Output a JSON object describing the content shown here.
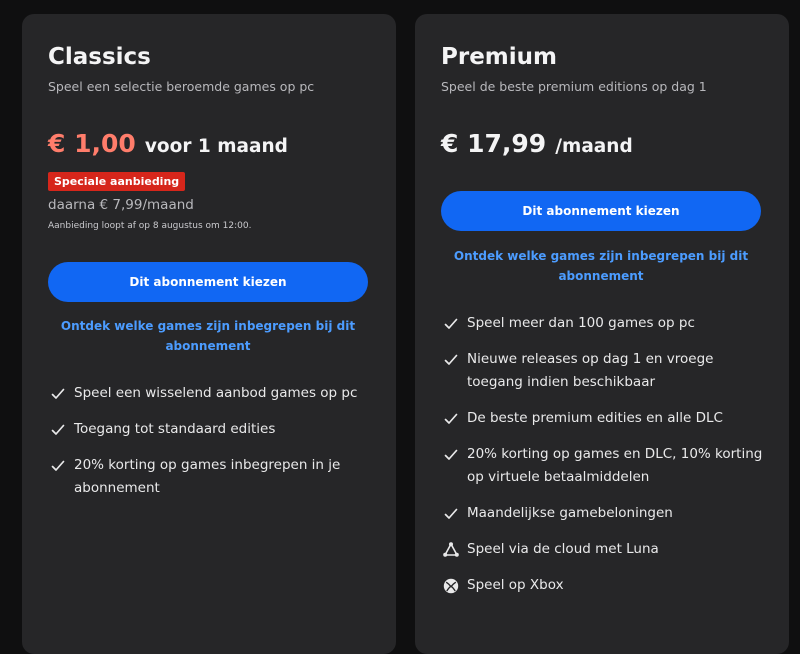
{
  "plans": [
    {
      "title": "Classics",
      "subtitle": "Speel een selectie beroemde games op pc",
      "price": "€ 1,00",
      "price_suffix": "voor 1 maand",
      "badge": "Speciale aanbieding",
      "after_price": "daarna € 7,99/maand",
      "offer_note": "Aanbieding loopt af op 8 augustus om 12:00.",
      "button_label": "Dit abonnement kiezen",
      "discover_link": "Ontdek welke games zijn inbegrepen bij dit abonnement",
      "features": [
        {
          "icon": "check-icon",
          "text": "Speel een wisselend aanbod games op pc"
        },
        {
          "icon": "check-icon",
          "text": "Toegang tot standaard edities"
        },
        {
          "icon": "check-icon",
          "text": "20% korting op games inbegrepen in je abonnement"
        }
      ]
    },
    {
      "title": "Premium",
      "subtitle": "Speel de beste premium editions op dag 1",
      "price": "€ 17,99",
      "price_suffix": "/maand",
      "button_label": "Dit abonnement kiezen",
      "discover_link": "Ontdek welke games zijn inbegrepen bij dit abonnement",
      "features": [
        {
          "icon": "check-icon",
          "text": "Speel meer dan 100 games op pc"
        },
        {
          "icon": "check-icon",
          "text": "Nieuwe releases op dag 1 en vroege toegang indien beschikbaar"
        },
        {
          "icon": "check-icon",
          "text": "De beste premium edities en alle DLC"
        },
        {
          "icon": "check-icon",
          "text": "20% korting op games en DLC, 10% korting op virtuele betaalmiddelen"
        },
        {
          "icon": "check-icon",
          "text": "Maandelijkse gamebeloningen"
        },
        {
          "icon": "luna-icon",
          "text": "Speel via de cloud met Luna"
        },
        {
          "icon": "xbox-icon",
          "text": "Speel op Xbox"
        }
      ]
    }
  ],
  "colors": {
    "accent_blue": "#1167f3",
    "link_blue": "#4c9cff",
    "promo_price": "#ff7d6b",
    "badge_red": "#d6261b",
    "card_bg": "#262628",
    "page_bg": "#0f0f10"
  }
}
